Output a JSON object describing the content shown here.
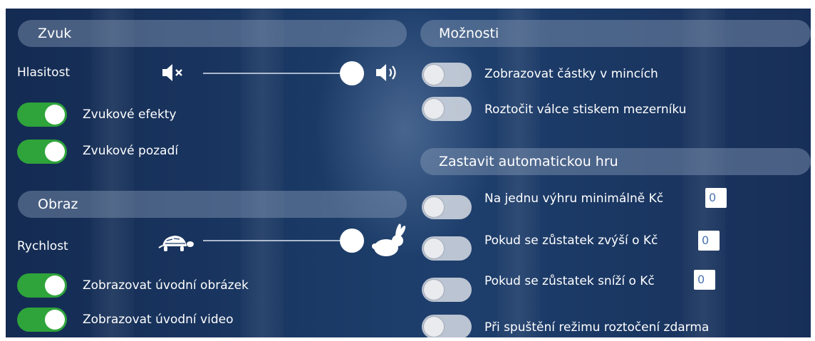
{
  "sound": {
    "header": "Zvuk",
    "volume_label": "Hlasitost",
    "volume_min_icon": "speaker-muted-icon",
    "volume_max_icon": "speaker-loud-icon",
    "volume_level": 1.0,
    "effects_label": "Zvukové efekty",
    "effects_on": true,
    "background_label": "Zvukové pozadí",
    "background_on": true
  },
  "image": {
    "header": "Obraz",
    "speed_label": "Rychlost",
    "speed_min_icon": "turtle-icon",
    "speed_max_icon": "rabbit-icon",
    "speed_level": 1.0,
    "intro_image_label": "Zobrazovat úvodní obrázek",
    "intro_image_on": true,
    "intro_video_label": "Zobrazovat úvodní video",
    "intro_video_on": true
  },
  "options": {
    "header": "Možnosti",
    "coins_label": "Zobrazovat částky v mincích",
    "coins_on": false,
    "spacebar_label": "Roztočit válce stiskem mezerníku",
    "spacebar_on": false
  },
  "autoplay": {
    "header": "Zastavit automatickou hru",
    "win_label": "Na jednu výhru minimálně Kč",
    "win_value": "0",
    "win_on": false,
    "increase_label": "Pokud se zůstatek zvýší o Kč",
    "increase_value": "0",
    "increase_on": false,
    "decrease_label": "Pokud se zůstatek sníží o Kč",
    "decrease_value": "0",
    "decrease_on": false,
    "freespins_label": "Při spuštění režimu roztočení zdarma",
    "freespins_on": false
  },
  "colors": {
    "toggle_on": "#2ea43a",
    "toggle_off": "#d7dce4",
    "header_bg": "#879bb9",
    "input_text": "#4b73b0"
  }
}
